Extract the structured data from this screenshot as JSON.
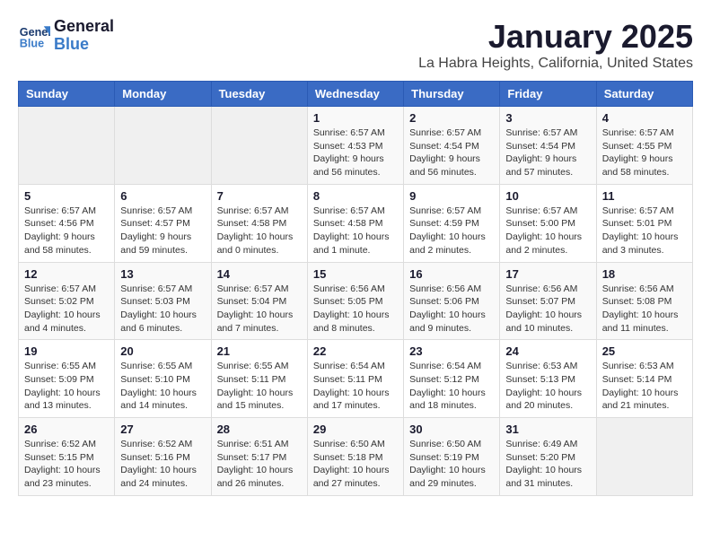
{
  "logo": {
    "line1": "General",
    "line2": "Blue"
  },
  "title": "January 2025",
  "subtitle": "La Habra Heights, California, United States",
  "days_of_week": [
    "Sunday",
    "Monday",
    "Tuesday",
    "Wednesday",
    "Thursday",
    "Friday",
    "Saturday"
  ],
  "weeks": [
    [
      {
        "day": "",
        "info": ""
      },
      {
        "day": "",
        "info": ""
      },
      {
        "day": "",
        "info": ""
      },
      {
        "day": "1",
        "info": "Sunrise: 6:57 AM\nSunset: 4:53 PM\nDaylight: 9 hours\nand 56 minutes."
      },
      {
        "day": "2",
        "info": "Sunrise: 6:57 AM\nSunset: 4:54 PM\nDaylight: 9 hours\nand 56 minutes."
      },
      {
        "day": "3",
        "info": "Sunrise: 6:57 AM\nSunset: 4:54 PM\nDaylight: 9 hours\nand 57 minutes."
      },
      {
        "day": "4",
        "info": "Sunrise: 6:57 AM\nSunset: 4:55 PM\nDaylight: 9 hours\nand 58 minutes."
      }
    ],
    [
      {
        "day": "5",
        "info": "Sunrise: 6:57 AM\nSunset: 4:56 PM\nDaylight: 9 hours\nand 58 minutes."
      },
      {
        "day": "6",
        "info": "Sunrise: 6:57 AM\nSunset: 4:57 PM\nDaylight: 9 hours\nand 59 minutes."
      },
      {
        "day": "7",
        "info": "Sunrise: 6:57 AM\nSunset: 4:58 PM\nDaylight: 10 hours\nand 0 minutes."
      },
      {
        "day": "8",
        "info": "Sunrise: 6:57 AM\nSunset: 4:58 PM\nDaylight: 10 hours\nand 1 minute."
      },
      {
        "day": "9",
        "info": "Sunrise: 6:57 AM\nSunset: 4:59 PM\nDaylight: 10 hours\nand 2 minutes."
      },
      {
        "day": "10",
        "info": "Sunrise: 6:57 AM\nSunset: 5:00 PM\nDaylight: 10 hours\nand 2 minutes."
      },
      {
        "day": "11",
        "info": "Sunrise: 6:57 AM\nSunset: 5:01 PM\nDaylight: 10 hours\nand 3 minutes."
      }
    ],
    [
      {
        "day": "12",
        "info": "Sunrise: 6:57 AM\nSunset: 5:02 PM\nDaylight: 10 hours\nand 4 minutes."
      },
      {
        "day": "13",
        "info": "Sunrise: 6:57 AM\nSunset: 5:03 PM\nDaylight: 10 hours\nand 6 minutes."
      },
      {
        "day": "14",
        "info": "Sunrise: 6:57 AM\nSunset: 5:04 PM\nDaylight: 10 hours\nand 7 minutes."
      },
      {
        "day": "15",
        "info": "Sunrise: 6:56 AM\nSunset: 5:05 PM\nDaylight: 10 hours\nand 8 minutes."
      },
      {
        "day": "16",
        "info": "Sunrise: 6:56 AM\nSunset: 5:06 PM\nDaylight: 10 hours\nand 9 minutes."
      },
      {
        "day": "17",
        "info": "Sunrise: 6:56 AM\nSunset: 5:07 PM\nDaylight: 10 hours\nand 10 minutes."
      },
      {
        "day": "18",
        "info": "Sunrise: 6:56 AM\nSunset: 5:08 PM\nDaylight: 10 hours\nand 11 minutes."
      }
    ],
    [
      {
        "day": "19",
        "info": "Sunrise: 6:55 AM\nSunset: 5:09 PM\nDaylight: 10 hours\nand 13 minutes."
      },
      {
        "day": "20",
        "info": "Sunrise: 6:55 AM\nSunset: 5:10 PM\nDaylight: 10 hours\nand 14 minutes."
      },
      {
        "day": "21",
        "info": "Sunrise: 6:55 AM\nSunset: 5:11 PM\nDaylight: 10 hours\nand 15 minutes."
      },
      {
        "day": "22",
        "info": "Sunrise: 6:54 AM\nSunset: 5:11 PM\nDaylight: 10 hours\nand 17 minutes."
      },
      {
        "day": "23",
        "info": "Sunrise: 6:54 AM\nSunset: 5:12 PM\nDaylight: 10 hours\nand 18 minutes."
      },
      {
        "day": "24",
        "info": "Sunrise: 6:53 AM\nSunset: 5:13 PM\nDaylight: 10 hours\nand 20 minutes."
      },
      {
        "day": "25",
        "info": "Sunrise: 6:53 AM\nSunset: 5:14 PM\nDaylight: 10 hours\nand 21 minutes."
      }
    ],
    [
      {
        "day": "26",
        "info": "Sunrise: 6:52 AM\nSunset: 5:15 PM\nDaylight: 10 hours\nand 23 minutes."
      },
      {
        "day": "27",
        "info": "Sunrise: 6:52 AM\nSunset: 5:16 PM\nDaylight: 10 hours\nand 24 minutes."
      },
      {
        "day": "28",
        "info": "Sunrise: 6:51 AM\nSunset: 5:17 PM\nDaylight: 10 hours\nand 26 minutes."
      },
      {
        "day": "29",
        "info": "Sunrise: 6:50 AM\nSunset: 5:18 PM\nDaylight: 10 hours\nand 27 minutes."
      },
      {
        "day": "30",
        "info": "Sunrise: 6:50 AM\nSunset: 5:19 PM\nDaylight: 10 hours\nand 29 minutes."
      },
      {
        "day": "31",
        "info": "Sunrise: 6:49 AM\nSunset: 5:20 PM\nDaylight: 10 hours\nand 31 minutes."
      },
      {
        "day": "",
        "info": ""
      }
    ]
  ]
}
